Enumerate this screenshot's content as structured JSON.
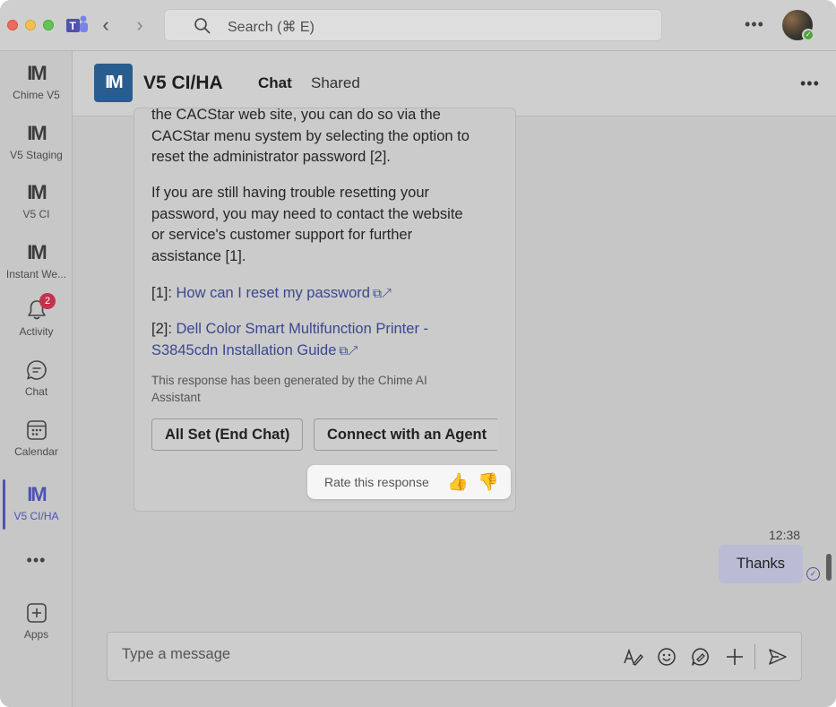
{
  "titlebar": {
    "search_placeholder": "Search (⌘ E)"
  },
  "rail": {
    "items": [
      {
        "label": "Chime V5",
        "icon": "im-logo-icon"
      },
      {
        "label": "V5 Staging",
        "icon": "im-logo-icon"
      },
      {
        "label": "V5 CI",
        "icon": "im-logo-icon"
      },
      {
        "label": "Instant We...",
        "icon": "im-logo-icon"
      },
      {
        "label": "Activity",
        "icon": "bell-icon",
        "badge": "2"
      },
      {
        "label": "Chat",
        "icon": "chat-icon"
      },
      {
        "label": "Calendar",
        "icon": "calendar-icon"
      },
      {
        "label": "V5 CI/HA",
        "icon": "im-logo-icon",
        "active": true
      },
      {
        "label": "Apps",
        "icon": "add-square-icon"
      }
    ],
    "im_text": "IM"
  },
  "header": {
    "logo_text": "IM",
    "title": "V5 CI/HA",
    "tabs": [
      {
        "label": "Chat",
        "active": true
      },
      {
        "label": "Shared",
        "active": false
      }
    ]
  },
  "message": {
    "para1_lines": [
      "the CACStar web site, you can do so via the",
      "CACStar menu system by selecting the option to",
      "reset the administrator password [2]."
    ],
    "para2_lines": [
      "If you are still having trouble resetting your",
      "password, you may need to contact the website",
      "or service's customer support for further",
      "assistance [1]."
    ],
    "ref1_prefix": "[1]: ",
    "ref1_link": "How can I reset my password",
    "ref2_prefix": "[2]: ",
    "ref2_link_line1": "Dell Color Smart Multifunction Printer -",
    "ref2_link_line2": "S3845cdn Installation Guide",
    "disclaimer_line1": "This response has been generated by the Chime AI",
    "disclaimer_line2": "Assistant",
    "btn_end_chat": "All Set (End Chat)",
    "btn_agent": "Connect with an Agent",
    "rate_label": "Rate this response"
  },
  "reply": {
    "time": "12:38",
    "text": "Thanks"
  },
  "composer": {
    "placeholder": "Type a message"
  },
  "colors": {
    "accent": "#4f52b2",
    "badge": "#c4314b",
    "team_logo": "#2a5d8f"
  }
}
